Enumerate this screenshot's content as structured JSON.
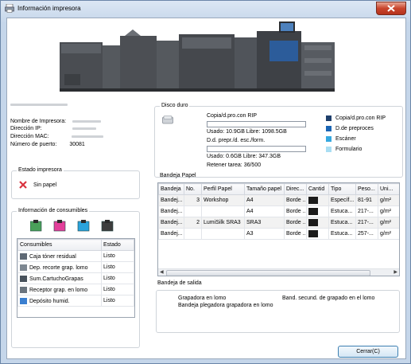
{
  "window": {
    "title": "Información impresora"
  },
  "printer_info": {
    "labels": [
      "Nombre de Impresora:",
      "Dirección IP:",
      "Dirección MAC:",
      "Número de puerto:"
    ],
    "port_value": "30081"
  },
  "printer_status": {
    "title": "Estado impresora",
    "status": "Sin papel",
    "status_color": "#d9333f"
  },
  "consumables": {
    "title": "Información de consumibles",
    "toner_colors": [
      "#4aa05a",
      "#e23f9a",
      "#2aa3dc",
      "#3d3d3d"
    ],
    "headers": [
      "Consumibles",
      "Estado"
    ],
    "rows": [
      {
        "name": "Caja tóner residual",
        "status": "Listo",
        "icon": "waste-toner-icon"
      },
      {
        "name": "Dep. recorte grap. lomo",
        "status": "Listo",
        "icon": "trim-box-icon"
      },
      {
        "name": "Sum.CartuchoGrapas",
        "status": "Listo",
        "icon": "staple-cartridge-icon"
      },
      {
        "name": "Receptor grap. en lomo",
        "status": "Listo",
        "icon": "staple-receiver-icon"
      },
      {
        "name": "Depósito humid.",
        "status": "Listo",
        "icon": "humidifier-tank-icon"
      }
    ]
  },
  "hard_disk": {
    "title": "Disco duro",
    "section1_label": "Copia/d.pro.con RIP",
    "section1_usage": "Usado: 10.9GB Libre: 1098.5GB",
    "section2_label": "D.d. prepr./d. esc./form.",
    "section2_usage": "Usado: 0.6GB Libre: 347.3GB",
    "retain": "Retener tarea: 36/500",
    "legend": [
      {
        "label": "Copia/d.pro.con RIP",
        "color": "#1f3f6b"
      },
      {
        "label": "D.de preproces",
        "color": "#1a65b4"
      },
      {
        "label": "Escáner",
        "color": "#35a8e0"
      },
      {
        "label": "Formulario",
        "color": "#a9def3"
      }
    ]
  },
  "paper_tray": {
    "title": "Bandeja Papel",
    "headers": [
      "Bandeja",
      "No.",
      "Perfil Papel",
      "Tamaño papel",
      "Direc...",
      "Cantid",
      "Tipo",
      "Peso...",
      "Uni..."
    ],
    "rows": [
      [
        "Bandej...",
        "3",
        "Workshop",
        "A4",
        "Borde ...",
        "",
        "Específ...",
        "81-91",
        "g/m²"
      ],
      [
        "Bandej...",
        "",
        "",
        "A4",
        "Borde ...",
        "",
        "Estuca...",
        "217-...",
        "g/m²"
      ],
      [
        "Bandej...",
        "2",
        "LumiSilk SRA3",
        "SRA3",
        "Borde ...",
        "",
        "Estuca...",
        "217-...",
        "g/m²"
      ],
      [
        "Bandej...",
        "",
        "",
        "A3",
        "Borde ...",
        "",
        "Estuca...",
        "257-...",
        "g/m²"
      ]
    ]
  },
  "output_tray": {
    "title": "Bandeja de salida",
    "items": [
      "Grapadora en lomo",
      "Bandeja plegadora grapadora en lomo",
      "Band. secund. de grapado en el lomo"
    ]
  },
  "footer": {
    "close_label": "Cerrar(C)"
  }
}
